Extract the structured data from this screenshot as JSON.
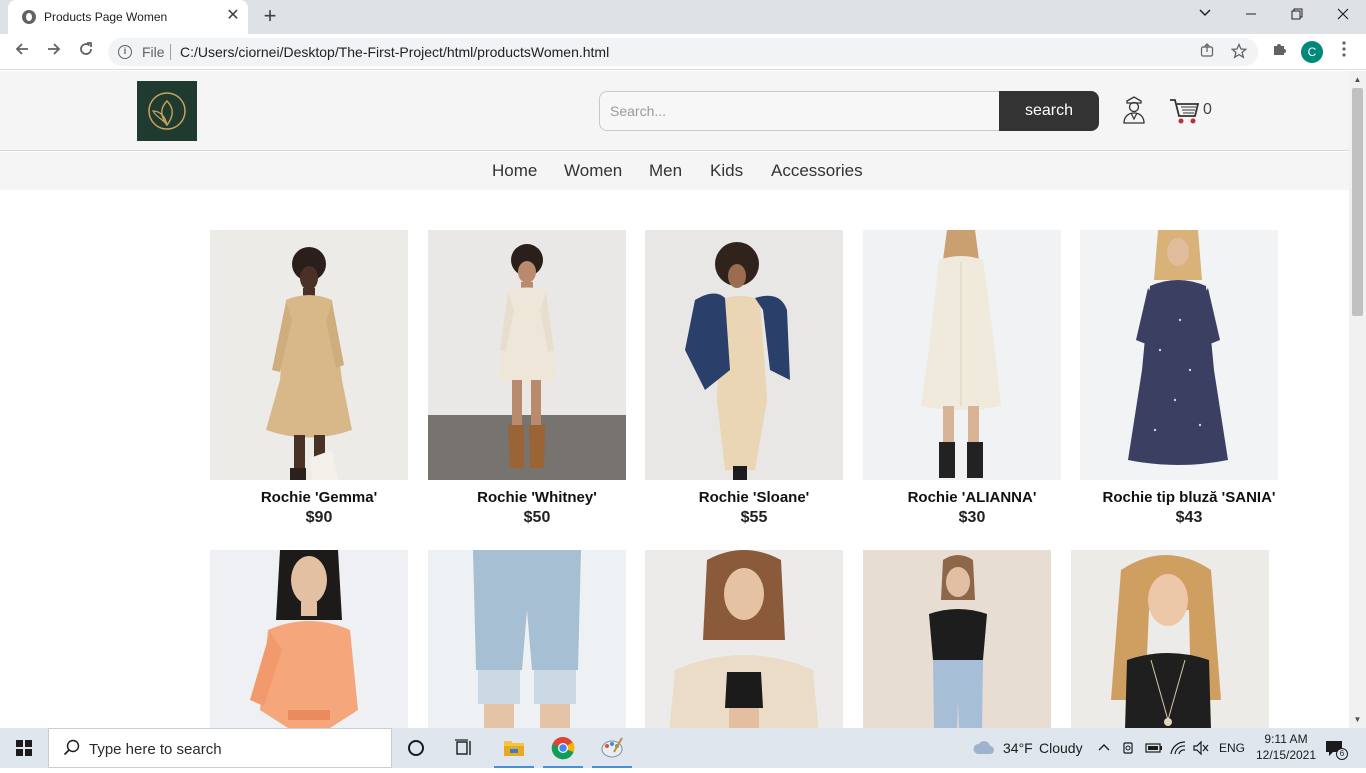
{
  "browser": {
    "tab_title": "Products Page Women",
    "tab_close": "✕",
    "new_tab": "+",
    "omnibox_scheme": "File",
    "url": "C:/Users/ciornei/Desktop/The-First-Project/html/productsWomen.html",
    "profile_initial": "C"
  },
  "header": {
    "search_placeholder": "Search...",
    "search_button": "search",
    "cart_count": "0"
  },
  "nav": {
    "items": [
      "Home",
      "Women",
      "Men",
      "Kids",
      "Accessories"
    ]
  },
  "products": [
    {
      "name": "Rochie 'Gemma'",
      "price": "$90"
    },
    {
      "name": "Rochie 'Whitney'",
      "price": "$50"
    },
    {
      "name": "Rochie 'Sloane'",
      "price": "$55"
    },
    {
      "name": "Rochie 'ALIANNA'",
      "price": "$30"
    },
    {
      "name": "Rochie tip bluză 'SANIA'",
      "price": "$43"
    },
    {
      "name": "",
      "price": ""
    },
    {
      "name": "",
      "price": ""
    },
    {
      "name": "",
      "price": ""
    },
    {
      "name": "",
      "price": ""
    },
    {
      "name": "",
      "price": ""
    }
  ],
  "taskbar": {
    "search_placeholder": "Type here to search",
    "weather_temp": "34°F",
    "weather_desc": "Cloudy",
    "lang": "ENG",
    "time": "9:11 AM",
    "date": "12/15/2021",
    "notifications": "6"
  },
  "colors": {
    "header_bg": "#f5f5f5",
    "search_button_bg": "#333333",
    "logo_bg": "#1f3b2f",
    "logo_gold": "#c9a25a",
    "profile_bg": "#00897b",
    "taskbar_bg": "#dfe6ee"
  }
}
